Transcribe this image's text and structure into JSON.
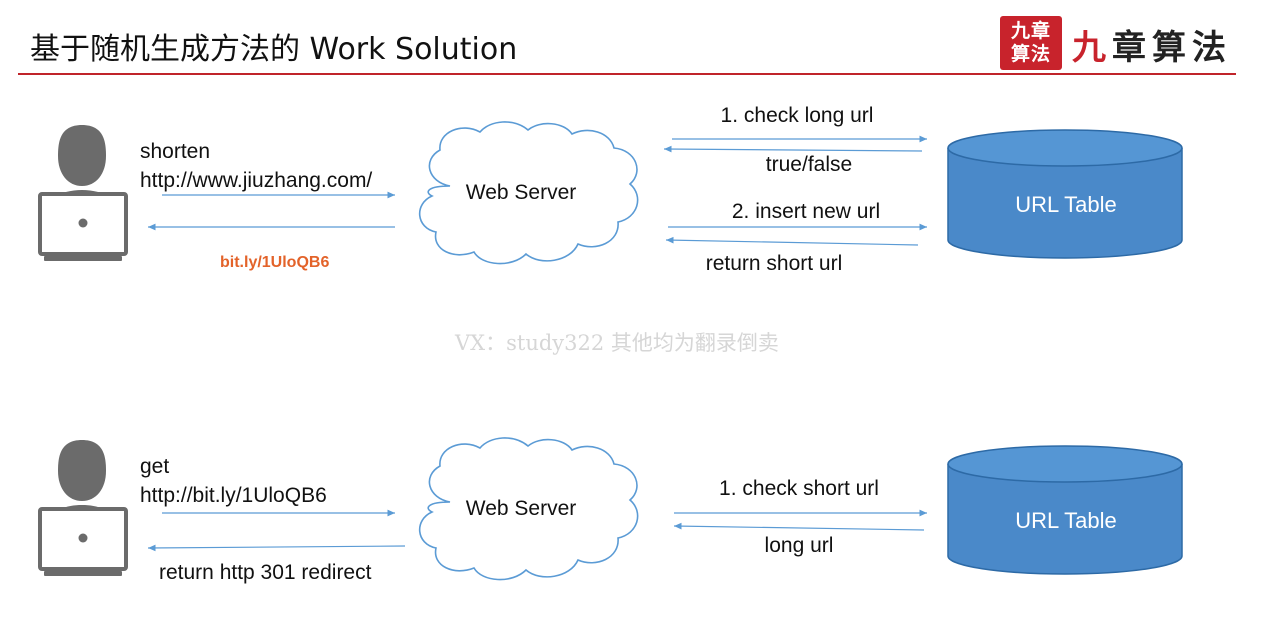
{
  "header": {
    "title": "基于随机生成方法的 Work Solution",
    "logo_seal": "九章算法",
    "logo_text": "九章算法",
    "accent_color": "#c0242a"
  },
  "top_flow": {
    "request_line1": "shorten",
    "request_line2": "http://www.jiuzhang.com/",
    "response": "bit.ly/1UloQB6",
    "server": "Web Server",
    "database": "URL Table",
    "step1_request": "1. check long url",
    "step1_response": "true/false",
    "step2_request": "2. insert new url",
    "step2_response": "return short url"
  },
  "watermark": "VX：study322 其他均为翻录倒卖",
  "bottom_flow": {
    "request_line1": "get",
    "request_line2": "http://bit.ly/1UloQB6",
    "response": "return http 301 redirect",
    "server": "Web Server",
    "database": "URL Table",
    "step1_request": "1. check short url",
    "step1_response": "long url"
  },
  "colors": {
    "arrow": "#5b9bd5",
    "cylinder_fill": "#4a89c9",
    "cylinder_stroke": "#2d6aa6",
    "cloud_stroke": "#5b9bd5",
    "user_icon": "#6b6b6b",
    "response_highlight": "#e3632a"
  }
}
